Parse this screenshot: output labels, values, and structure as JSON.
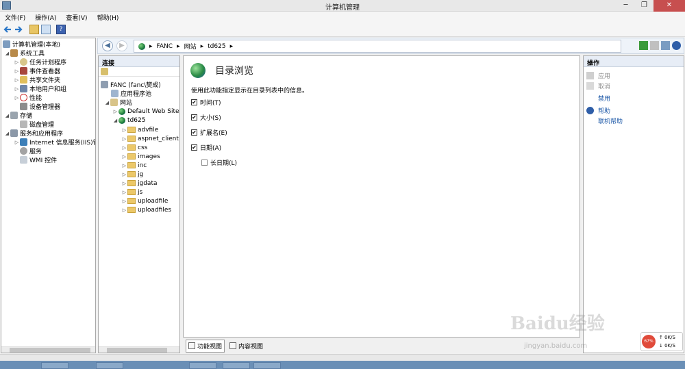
{
  "window": {
    "title": "计算机管理"
  },
  "menu": [
    "文件(F)",
    "操作(A)",
    "查看(V)",
    "帮助(H)"
  ],
  "tree": {
    "root": "计算机管理(本地)",
    "system_tools": "系统工具",
    "task_scheduler": "任务计划程序",
    "event_viewer": "事件查看器",
    "shared_folders": "共享文件夹",
    "local_users": "本地用户和组",
    "performance": "性能",
    "device_manager": "设备管理器",
    "storage": "存储",
    "disk_management": "磁盘管理",
    "services_apps": "服务和应用程序",
    "iis": "Internet 信息服务(IIS)管",
    "services": "服务",
    "wmi": "WMI 控件"
  },
  "address": {
    "crumbs": [
      "FANC",
      "网站",
      "td625"
    ],
    "sep": "▸"
  },
  "connections": {
    "header": "连接",
    "server": "FANC (fanc\\樊成)",
    "app_pools": "应用程序池",
    "sites": "网站",
    "default_site": "Default Web Site",
    "td625": "td625",
    "folders": [
      "advfile",
      "aspnet_client",
      "css",
      "images",
      "inc",
      "jg",
      "jgdata",
      "js",
      "uploadfile",
      "uploadfiles"
    ]
  },
  "main": {
    "title": "目录浏览",
    "description": "使用此功能指定显示在目录列表中的信息。",
    "options": {
      "time": "时间(T)",
      "size": "大小(S)",
      "extension": "扩展名(E)",
      "date": "日期(A)",
      "long_date": "长日期(L)"
    },
    "checked": {
      "time": true,
      "size": true,
      "extension": true,
      "date": true,
      "long_date": false
    }
  },
  "views": {
    "features": "功能视图",
    "content": "内容视图"
  },
  "actions": {
    "header": "操作",
    "apply": "应用",
    "cancel": "取消",
    "disable": "禁用",
    "help": "帮助",
    "online_help": "联机帮助"
  },
  "watermark": {
    "main": "Baidu经验",
    "sub": "jingyan.baidu.com"
  },
  "net_widget": {
    "percent": "67%",
    "up": "0K/S",
    "down": "0K/S"
  }
}
